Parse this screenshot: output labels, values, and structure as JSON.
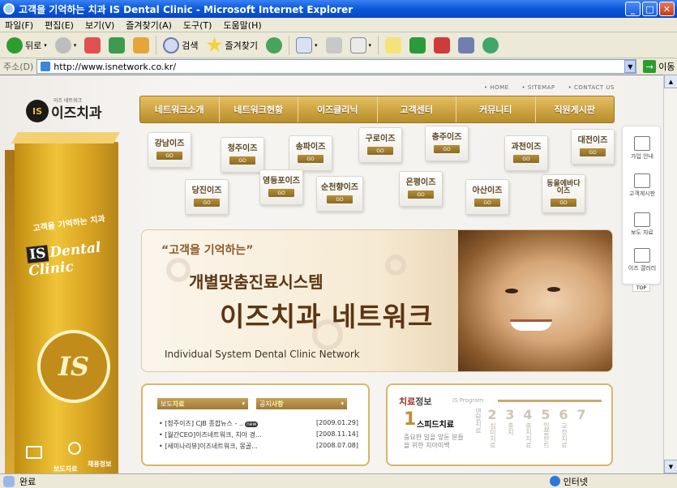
{
  "window": {
    "title": "고객을 기억하는 치과 IS Dental Clinic - Microsoft Internet Explorer",
    "buttons": [
      "minimize",
      "maximize",
      "close"
    ]
  },
  "menu": [
    "파일(F)",
    "편집(E)",
    "보기(V)",
    "즐겨찾기(A)",
    "도구(T)",
    "도움말(H)"
  ],
  "toolbar": {
    "back_label": "뒤로",
    "search_label": "검색",
    "favorites_label": "즐겨찾기"
  },
  "address": {
    "label": "주소(D)",
    "url": "http://www.isnetwork.co.kr/",
    "go_label": "이동"
  },
  "status": {
    "text": "완료",
    "zone": "인터넷"
  },
  "site": {
    "top_links": [
      "• HOME",
      "• SITEMAP",
      "• CONTACT US"
    ],
    "logo_small": "이즈 네트워크",
    "logo_name": "이즈치과",
    "logo_mark": "IS",
    "nav": [
      "네트워크소개",
      "네트워크현황",
      "이즈클리닉",
      "고객센터",
      "커뮤니티",
      "직원게시판"
    ],
    "clinics": [
      {
        "name": "강남이즈",
        "go": "GO"
      },
      {
        "name": "청주이즈",
        "go": "GO"
      },
      {
        "name": "송파이즈",
        "go": "GO"
      },
      {
        "name": "구로이즈",
        "go": "GO"
      },
      {
        "name": "충주이즈",
        "go": "GO"
      },
      {
        "name": "과천이즈",
        "go": "GO"
      },
      {
        "name": "대전이즈",
        "go": "GO"
      },
      {
        "name": "당진이즈",
        "go": "GO"
      },
      {
        "name": "영등포이즈",
        "go": "GO"
      },
      {
        "name": "순천향이즈",
        "go": "GO"
      },
      {
        "name": "은평이즈",
        "go": "GO"
      },
      {
        "name": "아산이즈",
        "go": "GO"
      },
      {
        "name": "동을에바다 이즈",
        "go": "GO"
      }
    ],
    "box": {
      "tagline": "고객을 기억하는 치과",
      "brand_is": "IS",
      "brand_rest": "Dental Clinic",
      "emblem": "IS",
      "sub1": "보도자료",
      "sub2": "채용정보"
    },
    "banner": {
      "quote": "“고객을 기억하는”",
      "line1": "개별맞춤진료시스템",
      "line2": "이즈치과 네트워크",
      "english": "Individual System Dental Clinic Network"
    },
    "news": {
      "tab1_a": "보도",
      "tab1_b": "자료",
      "tab2_a": "공지",
      "tab2_b": "사항",
      "items": [
        {
          "title": "• [청주이즈] CJB 종합뉴스 - ..",
          "badge": "new",
          "date": "[2009.01.29]"
        },
        {
          "title": "• [월간CEO]이즈네트워크, 치아 경...",
          "date": "[2008.11.14]"
        },
        {
          "title": "• [세미나리뷰]이즈네트워크, 몽골...",
          "date": "[2008.07.08]"
        }
      ]
    },
    "program": {
      "title_a": "치료",
      "title_b": "정보",
      "subtitle": "IS Program",
      "first_num": "1",
      "first_label": "스피드치료",
      "desc": "중요한 일을 앞둔 분들을 위한 치아미백",
      "columns": [
        {
          "num": "",
          "label": "덴탈치료"
        },
        {
          "num": "2",
          "label": "심미치료"
        },
        {
          "num": "3",
          "label": "충치"
        },
        {
          "num": "4",
          "label": "충치치료"
        },
        {
          "num": "5",
          "label": "임플란트"
        },
        {
          "num": "6",
          "label": "교정치료"
        },
        {
          "num": "7",
          "label": ""
        }
      ]
    },
    "quick": [
      "가입 안내",
      "고객게시판",
      "보도 자료",
      "이즈 갤러리"
    ],
    "quick_top": "TOP"
  }
}
